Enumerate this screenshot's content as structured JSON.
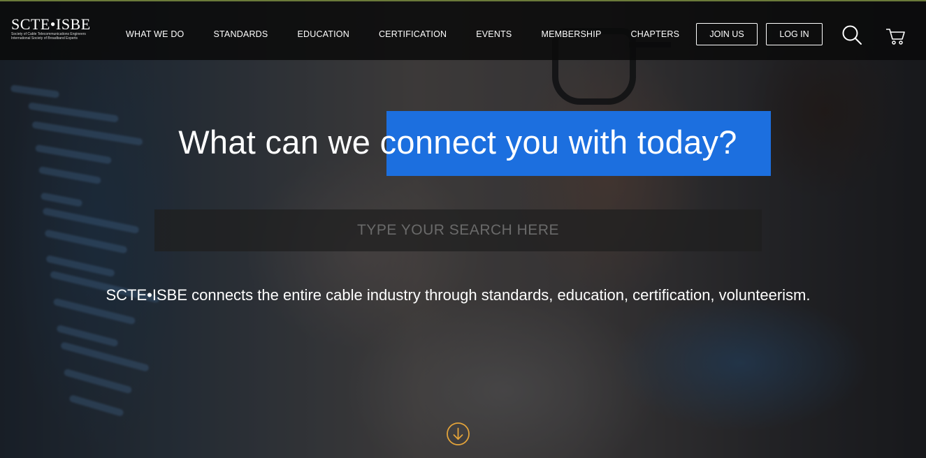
{
  "logo": {
    "mark": "SCTE•ISBE",
    "sub_line_1": "Society of Cable Telecommunications Engineers",
    "sub_line_2": "International Society of Broadband Experts"
  },
  "nav": {
    "items": [
      {
        "label": "WHAT WE DO"
      },
      {
        "label": "STANDARDS"
      },
      {
        "label": "EDUCATION"
      },
      {
        "label": "CERTIFICATION"
      },
      {
        "label": "EVENTS"
      },
      {
        "label": "MEMBERSHIP"
      },
      {
        "label": "CHAPTERS"
      }
    ]
  },
  "header": {
    "join_label": "JOIN US",
    "login_label": "LOG IN",
    "search_icon": "search-icon",
    "cart_icon": "cart-icon"
  },
  "hero": {
    "headline": "What can we connect you with today?",
    "search_placeholder": "TYPE YOUR SEARCH HERE",
    "search_value": "",
    "tagline": "SCTE•ISBE connects the entire cable industry through standards, education, certification, volunteerism.",
    "scroll_icon": "arrow-down-circle-icon"
  },
  "colors": {
    "header_bg": "#0a0a0a",
    "highlight": "#1c6fdf",
    "scroll_accent": "#e3a33a",
    "text": "#ffffff"
  }
}
